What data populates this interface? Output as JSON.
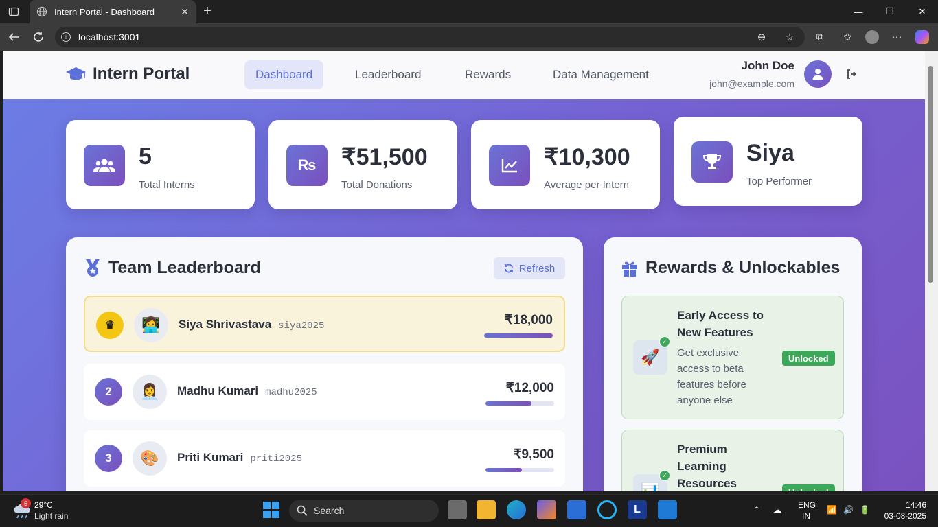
{
  "browser": {
    "tab_title": "Intern Portal - Dashboard",
    "url": "localhost:3001"
  },
  "app": {
    "brand": "Intern Portal",
    "nav": [
      {
        "label": "Dashboard",
        "active": true
      },
      {
        "label": "Leaderboard",
        "active": false
      },
      {
        "label": "Rewards",
        "active": false
      },
      {
        "label": "Data Management",
        "active": false
      }
    ],
    "user": {
      "name": "John Doe",
      "email": "john@example.com"
    }
  },
  "stats": [
    {
      "value": "5",
      "label": "Total Interns",
      "icon": "users-icon"
    },
    {
      "value": "₹51,500",
      "label": "Total Donations",
      "icon": "rupee-icon"
    },
    {
      "value": "₹10,300",
      "label": "Average per Intern",
      "icon": "chart-line-icon"
    },
    {
      "value": "Siya",
      "label": "Top Performer",
      "icon": "trophy-icon"
    }
  ],
  "leaderboard": {
    "title": "Team Leaderboard",
    "refresh_label": "Refresh",
    "rows": [
      {
        "rank": "♛",
        "emoji": "👩‍💻",
        "name": "Siya Shrivastava",
        "username": "siya2025",
        "amount": "₹18,000",
        "progress": 1.0
      },
      {
        "rank": "2",
        "emoji": "👩‍💼",
        "name": "Madhu Kumari",
        "username": "madhu2025",
        "amount": "₹12,000",
        "progress": 0.67
      },
      {
        "rank": "3",
        "emoji": "🎨",
        "name": "Priti Kumari",
        "username": "priti2025",
        "amount": "₹9,500",
        "progress": 0.53
      }
    ]
  },
  "rewards": {
    "title": "Rewards & Unlockables",
    "items": [
      {
        "title": "Early Access to New Features",
        "description": "Get exclusive access to beta features before anyone else",
        "status": "Unlocked",
        "emoji": "🚀"
      },
      {
        "title": "Premium Learning Resources",
        "description": "",
        "status": "Unlocked",
        "emoji": "📊"
      }
    ]
  },
  "taskbar": {
    "weather_badge": "5",
    "temperature": "29°C",
    "weather": "Light rain",
    "search_placeholder": "Search",
    "language": "ENG",
    "region": "IN",
    "time": "14:46",
    "date": "03-08-2025"
  }
}
